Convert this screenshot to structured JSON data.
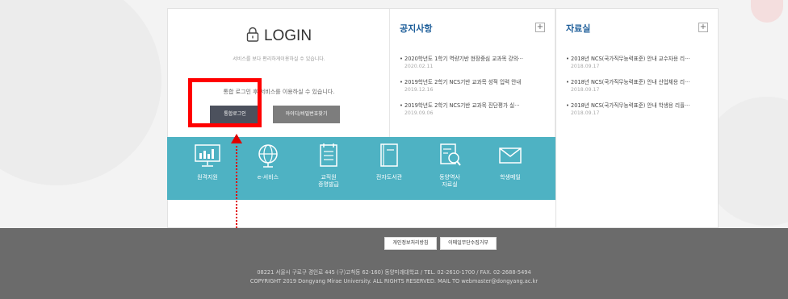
{
  "login": {
    "title": "LOGIN",
    "subtitle": "서비스를 보다 편리하게이용하실 수 있습니다.",
    "message": "통합 로그인 후 서비스를 이용하실 수 있습니다.",
    "login_button": "통합로그인",
    "find_button": "아이디/비밀번호찾기"
  },
  "notice": {
    "title": "공지사항",
    "items": [
      {
        "text": "2020학년도 1학기 역량기반 현장중심 교과목 강의···",
        "date": "2020.02.11"
      },
      {
        "text": "2019학년도 2학기 NCS기반 교과목 성적 입력 안내",
        "date": "2019.12.16"
      },
      {
        "text": "2019학년도 2학기 NCS기반 교과목 진단평가 실···",
        "date": "2019.09.06"
      }
    ]
  },
  "files": {
    "title": "자료실",
    "items": [
      {
        "text": "2018년 NCS(국가직무능력표준) 안내 교수자용 리···",
        "date": "2018.09.17"
      },
      {
        "text": "2018년 NCS(국가직무능력표준) 안내 산업체용 리···",
        "date": "2018.09.17"
      },
      {
        "text": "2018년 NCS(국가직무능력표준) 안내 학생용 리플···",
        "date": "2018.09.17"
      }
    ]
  },
  "quicklinks": [
    {
      "label": "원격지원",
      "icon": "monitor-chart-icon"
    },
    {
      "label": "e-서비스",
      "icon": "globe-icon"
    },
    {
      "label": "교직원\n증명발급",
      "icon": "calendar-document-icon"
    },
    {
      "label": "전자도서관",
      "icon": "book-icon"
    },
    {
      "label": "동양역사\n자료실",
      "icon": "search-document-icon"
    },
    {
      "label": "학생메일",
      "icon": "mail-icon"
    }
  ],
  "footer": {
    "privacy": "개인정보처리방침",
    "email_refuse": "이메일무단수집거부",
    "address": "08221 서울시 구로구 경인로 445 (구)고척동 62-160) 동양미래대학교 / TEL. 02-2610-1700 / FAX. 02-2688-5494",
    "copyright": "COPYRIGHT 2019 Dongyang Mirae University. ALL RIGHTS RESERVED. MAIL TO webmaster@dongyang.ac.kr"
  },
  "colors": {
    "teal": "#4eb2c3",
    "highlight": "#ff0000",
    "heading_blue": "#1c5d99"
  }
}
